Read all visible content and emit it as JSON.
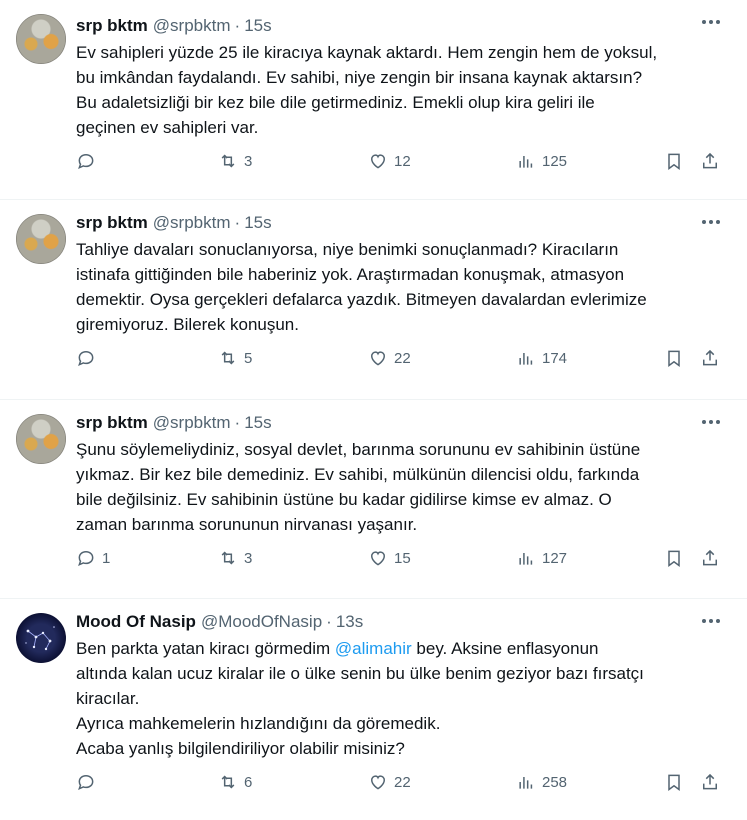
{
  "tweets": [
    {
      "name": "srp bktm",
      "handle": "@srpbktm",
      "time": "15s",
      "text": "Ev sahipleri yüzde 25 ile kiracıya kaynak aktardı. Hem zengin hem de yoksul,\nbu imkândan faydalandı. Ev sahibi, niye zengin bir insana kaynak aktarsın?\nBu adaletsizliği bir kez bile dile getirmediniz. Emekli olup kira geliri ile\ngeçinen ev sahipleri var.",
      "replies": "",
      "retweets": "3",
      "likes": "12",
      "views": "125"
    },
    {
      "name": "srp bktm",
      "handle": "@srpbktm",
      "time": "15s",
      "text": "Tahliye davaları sonuclanıyorsa, niye benimki sonuçlanmadı? Kiracıların\nistinafa gittiğinden bile haberiniz yok. Araştırmadan konuşmak, atmasyon\ndemektir. Oysa gerçekleri defalarca yazdık. Bitmeyen davalardan evlerimize\ngiremiyoruz. Bilerek konuşun.",
      "replies": "",
      "retweets": "5",
      "likes": "22",
      "views": "174"
    },
    {
      "name": "srp bktm",
      "handle": "@srpbktm",
      "time": "15s",
      "text": "Şunu söylemeliydiniz, sosyal devlet, barınma sorununu ev sahibinin üstüne\nyıkmaz. Bir kez bile demediniz. Ev sahibi, mülkünün dilencisi oldu, farkında\nbile değilsiniz. Ev sahibinin üstüne bu kadar gidilirse kimse ev almaz. O\nzaman barınma sorununun nirvanası yaşanır.",
      "replies": "1",
      "retweets": "3",
      "likes": "15",
      "views": "127"
    },
    {
      "name": "Mood Of Nasip",
      "handle": "@MoodOfNasip",
      "time": "13s",
      "text_before": "Ben parkta yatan kiracı görmedim ",
      "mention": "@alimahir",
      "text_after": " bey. Aksine enflasyonun\naltında kalan ucuz kiralar ile o ülke senin bu ülke benim geziyor bazı fırsatçı\nkiracılar.\nAyrıca mahkemelerin hızlandığını da göremedik.\nAcaba yanlış bilgilendiriliyor olabilir misiniz?",
      "replies": "",
      "retweets": "6",
      "likes": "22",
      "views": "258"
    }
  ],
  "separator": "·"
}
